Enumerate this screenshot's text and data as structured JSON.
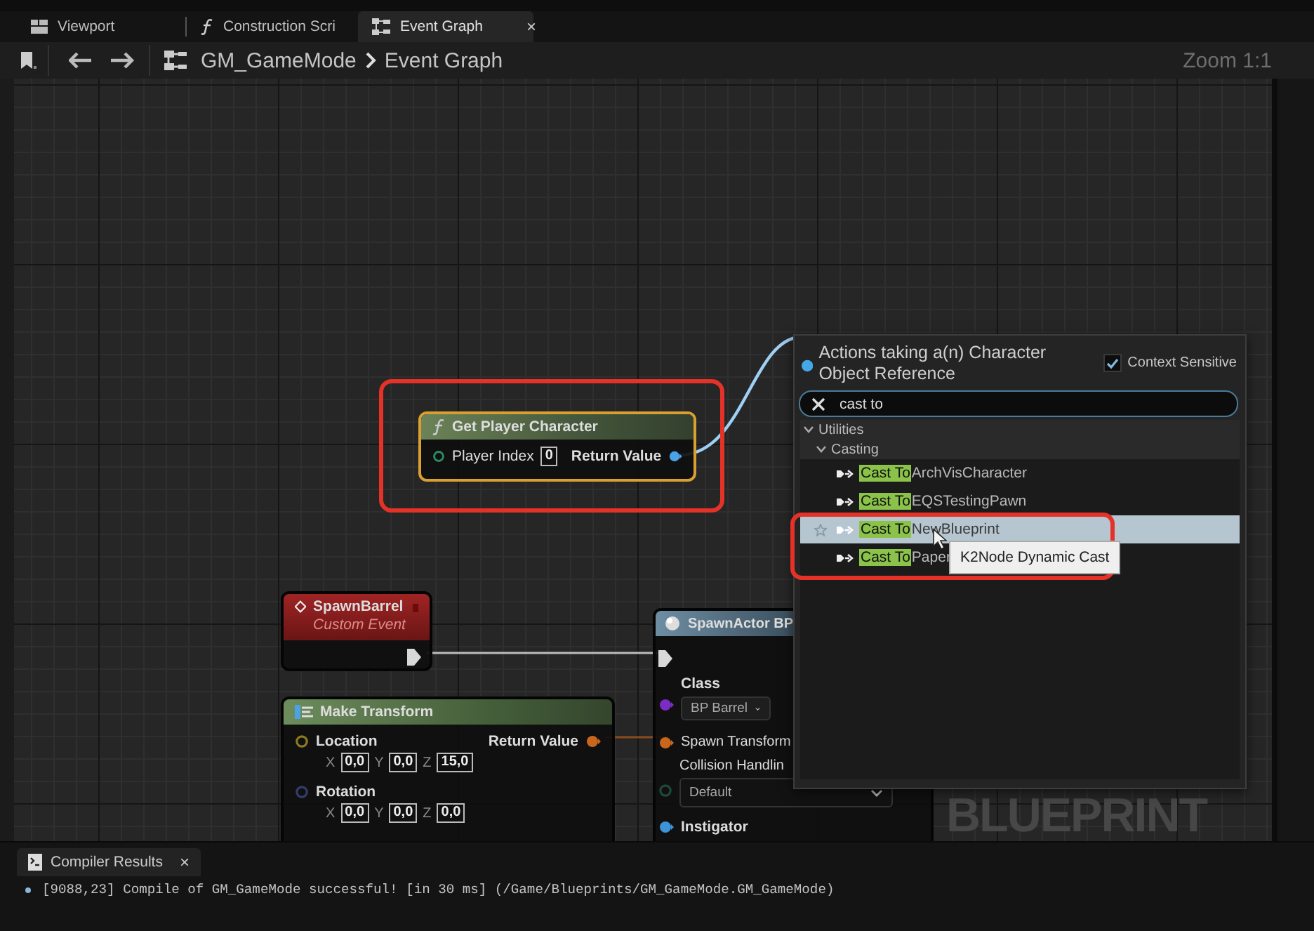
{
  "tabs": [
    {
      "label": "Viewport",
      "selected": false
    },
    {
      "label": "Construction Scri",
      "selected": false
    },
    {
      "label": "Event Graph",
      "selected": true,
      "close": "×"
    }
  ],
  "breadcrumb": [
    "GM_GameMode",
    "Event Graph"
  ],
  "zoom": "Zoom 1:1",
  "graph": {
    "watermark": "BLUEPRINT",
    "nodes": [
      {
        "kind": "function",
        "title": "Get Player Character",
        "selected": true,
        "highlighted": true,
        "input": {
          "label": "Player Index",
          "value": "0"
        },
        "output": "Return Value"
      },
      {
        "kind": "event",
        "title": "SpawnBarrel",
        "subtitle": "Custom Event",
        "selected": false,
        "highlighted": false
      },
      {
        "kind": "make_transform",
        "title": "Make Transform",
        "selected": false,
        "highlighted": false,
        "output": "Return Value",
        "vectors": [
          {
            "label": "Location",
            "components": [
              {
                "axis": "X",
                "value": "0,0"
              },
              {
                "axis": "Y",
                "value": "0,0"
              },
              {
                "axis": "Z",
                "value": "15,0"
              }
            ]
          },
          {
            "label": "Rotation",
            "components": [
              {
                "axis": "X",
                "value": "0,0"
              },
              {
                "axis": "Y",
                "value": "0,0"
              },
              {
                "axis": "Z",
                "value": "0,0"
              }
            ]
          }
        ]
      },
      {
        "kind": "spawn_actor",
        "title": "SpawnActor BP",
        "selected": false,
        "highlighted": false,
        "class": {
          "label": "Class",
          "value": "BP Barrel"
        },
        "transform": "Spawn Transform",
        "collision": {
          "label": "Collision Handlin",
          "value": "Default"
        },
        "instigator": "Instigator"
      }
    ]
  },
  "action_menu": {
    "title": "Actions taking a(n) Character Object Reference",
    "context_sensitive": {
      "label": "Context Sensitive",
      "checked": true
    },
    "search": {
      "value": "cast to"
    },
    "tree": [
      {
        "label": "Utilities",
        "expanded": true,
        "children": [
          {
            "label": "Casting",
            "expanded": true,
            "children": [
              {
                "match": "Cast To",
                "rest": "ArchVisCharacter",
                "selected": false,
                "highlighted": false
              },
              {
                "match": "Cast To",
                "rest": "EQSTestingPawn",
                "selected": false,
                "highlighted": false
              },
              {
                "match": "Cast To",
                "rest": "NewBlueprint",
                "selected": true,
                "highlighted": true
              },
              {
                "match": "Cast To",
                "rest": "Paper",
                "selected": false,
                "highlighted": true
              }
            ]
          }
        ]
      }
    ],
    "tooltip": "K2Node Dynamic Cast"
  },
  "compiler_results": {
    "tab": "Compiler Results",
    "close": "×",
    "messages": [
      "[9088,23] Compile of GM_GameMode successful! [in 30 ms] (/Game/Blueprints/GM_GameMode.GM_GameMode)"
    ]
  }
}
